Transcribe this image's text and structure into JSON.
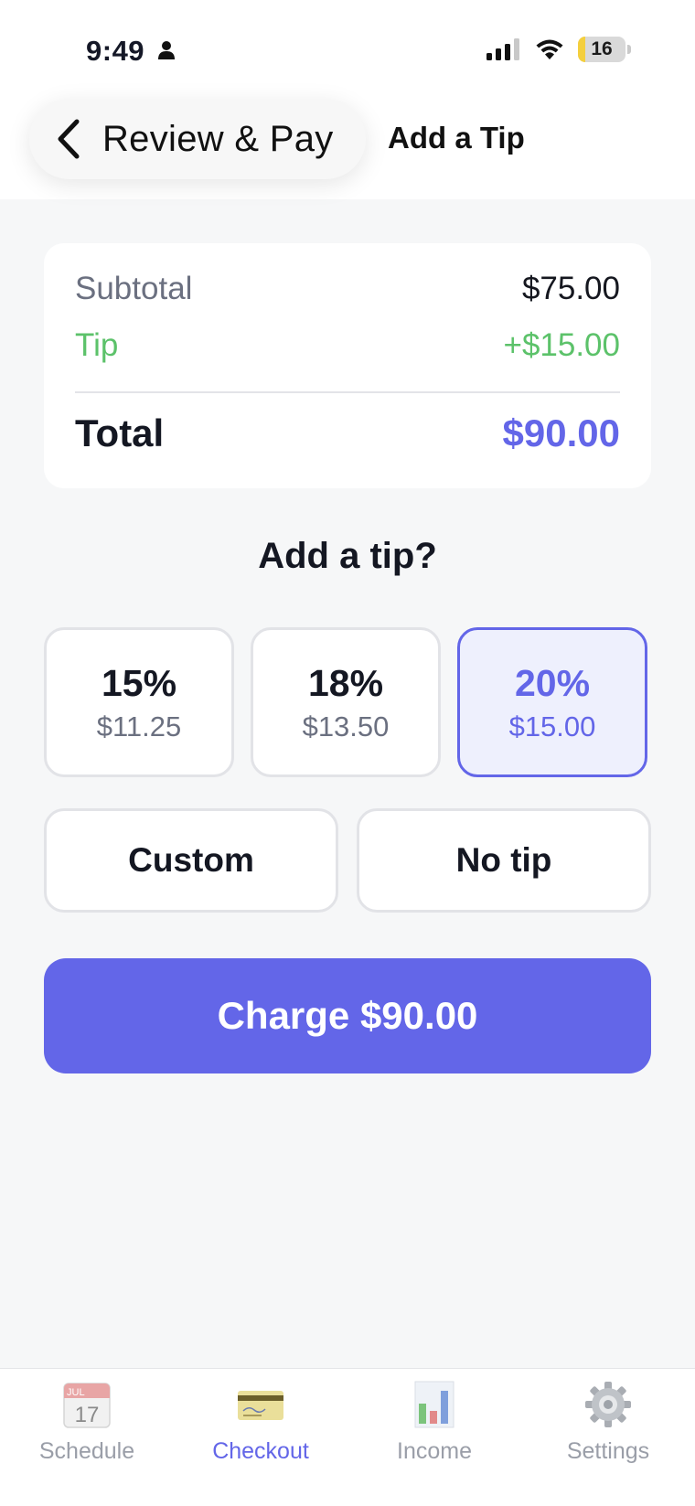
{
  "status_bar": {
    "time": "9:49",
    "battery_level": "16",
    "battery_fraction": 0.16
  },
  "nav": {
    "back_label": "Review & Pay",
    "title": "Add a Tip"
  },
  "summary": {
    "subtotal_label": "Subtotal",
    "subtotal_value": "$75.00",
    "tip_label": "Tip",
    "tip_value": "+$15.00",
    "total_label": "Total",
    "total_value": "$90.00"
  },
  "tip_heading": "Add a tip?",
  "tip_options": [
    {
      "percent": "15%",
      "amount": "$11.25",
      "selected": false
    },
    {
      "percent": "18%",
      "amount": "$13.50",
      "selected": false
    },
    {
      "percent": "20%",
      "amount": "$15.00",
      "selected": true
    }
  ],
  "custom_label": "Custom",
  "no_tip_label": "No tip",
  "charge_label": "Charge $90.00",
  "tabs": [
    {
      "label": "Schedule",
      "icon": "calendar-icon",
      "active": false
    },
    {
      "label": "Checkout",
      "icon": "credit-card-icon",
      "active": true
    },
    {
      "label": "Income",
      "icon": "bar-chart-icon",
      "active": false
    },
    {
      "label": "Settings",
      "icon": "gear-icon",
      "active": false
    }
  ],
  "calendar_icon": {
    "month": "JUL",
    "day": "17"
  },
  "colors": {
    "accent": "#6366e8",
    "tip_green": "#5cc26a",
    "selected_bg": "#eef0fd"
  }
}
